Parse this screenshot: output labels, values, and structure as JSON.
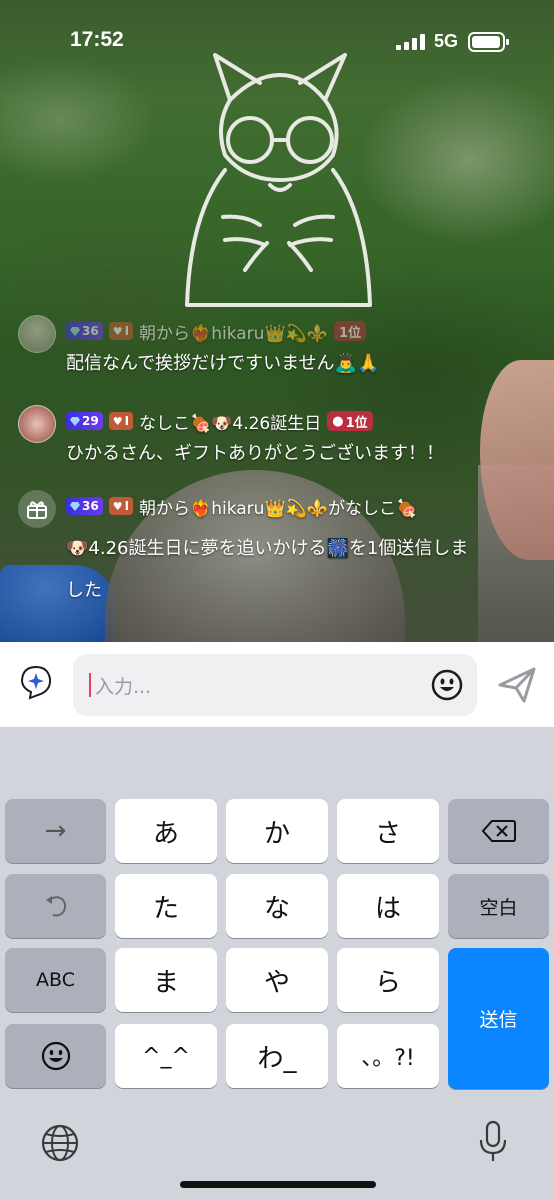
{
  "status_bar": {
    "time": "17:52",
    "network": "5G",
    "signal_icon": "cellular-signal-icon",
    "battery_icon": "battery-icon"
  },
  "stream": {
    "overlay_icon": "raccoon-mascot-outline-icon"
  },
  "chat": {
    "messages": [
      {
        "avatar_icon": "user-avatar",
        "gem_level": "36",
        "heart_level": "I",
        "username": "朝から",
        "heart_emoji": "❤️‍🔥",
        "name_part": "hikaru",
        "emoji_suffix": "👑💫⚜️",
        "rank": "1位",
        "text": "配信なんで挨拶だけですいません🙇‍♂️🙏"
      },
      {
        "avatar_icon": "user-avatar",
        "gem_level": "29",
        "heart_level": "I",
        "username": "なしこ🍖🐶4.26誕生日",
        "rank": "1位",
        "text": "ひかるさん、ギフトありがとうございます！！"
      },
      {
        "type": "gift",
        "avatar_icon": "gift-icon",
        "gem_level": "36",
        "heart_level": "I",
        "line1": "朝から❤️‍🔥hikaru👑💫⚜️がなしこ🍖",
        "line2": "🐶4.26誕生日に夢を追いかける🎆を1個送信しま",
        "line3": "した"
      }
    ]
  },
  "input_bar": {
    "placeholder": "入力...",
    "sparkle_icon": "sparkle-icon",
    "emoji_icon": "smiley-icon",
    "send_icon": "send-arrow-icon"
  },
  "keyboard": {
    "rows": [
      [
        "→",
        "あ",
        "か",
        "さ",
        "⌫"
      ],
      [
        "↺",
        "た",
        "な",
        "は",
        "空白"
      ],
      [
        "ABC",
        "ま",
        "や",
        "ら",
        "送信"
      ],
      [
        "😀",
        "^^",
        "わ_",
        "、。?!"
      ]
    ],
    "keys": {
      "next": "→",
      "a": "あ",
      "ka": "か",
      "sa": "さ",
      "undo": "↺",
      "ta": "た",
      "na": "な",
      "ha": "は",
      "space": "空白",
      "abc": "ABC",
      "ma": "ま",
      "ya": "や",
      "ra": "ら",
      "send": "送信",
      "emoji": "😀",
      "kaomoji": "^_^",
      "wa": "わ_",
      "punct": "、。?!"
    },
    "globe_icon": "globe-icon",
    "mic_icon": "microphone-icon",
    "delete_icon": "backspace-icon",
    "undo_icon": "undo-icon"
  }
}
